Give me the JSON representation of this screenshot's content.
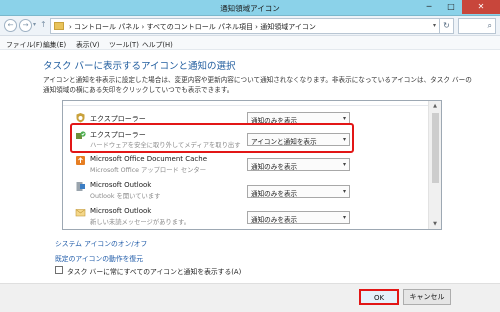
{
  "window": {
    "title": "通知領域アイコン",
    "minimize": "─",
    "maximize": "□",
    "close": "✕"
  },
  "nav": {
    "back": "←",
    "forward": "→",
    "recent": "▾",
    "up": "↑",
    "breadcrumb": "›  コントロール パネル  ›  すべてのコントロール パネル項目  ›  通知領域アイコン",
    "dropdown": "▾",
    "refresh": "↻",
    "search": "⌕"
  },
  "menu": [
    "ファイル(F)",
    "編集(E)",
    "表示(V)",
    "ツール(T)",
    "ヘルプ(H)"
  ],
  "heading": "タスク バーに表示するアイコンと通知の選択",
  "description": "アイコンと通知を非表示に設定した場合は、変更内容や更新内容について通知されなくなります。非表示になっているアイコンは、タスク バーの通知領域の横にある矢印をクリックしていつでも表示できます。",
  "list": {
    "items": [
      {
        "name": "エクスプローラー",
        "sub": "",
        "icon": "explorer-shield-icon",
        "behavior": "通知のみを表示"
      },
      {
        "name": "エクスプローラー",
        "sub": "ハードウェアを安全に取り外してメディアを取り出す",
        "icon": "safely-remove-hardware-icon",
        "behavior": "アイコンと通知を表示"
      },
      {
        "name": "Microsoft Office Document Cache",
        "sub": "Microsoft Office アップロード センター",
        "icon": "office-upload-icon",
        "behavior": "通知のみを表示"
      },
      {
        "name": "Microsoft Outlook",
        "sub": "Outlook を開いています",
        "icon": "outlook-icon",
        "behavior": "通知のみを表示"
      },
      {
        "name": "Microsoft Outlook",
        "sub": "新しい未読メッセージがあります。",
        "icon": "outlook-mail-icon",
        "behavior": "通知のみを表示"
      }
    ],
    "dropdown_arrow": "▾",
    "scroll_up": "▲",
    "scroll_down": "▼"
  },
  "links": {
    "system_icons": "システム アイコンのオン/オフ",
    "restore_defaults": "既定のアイコンの動作を復元"
  },
  "checkbox": {
    "label": "タスク バーに常にすべてのアイコンと通知を表示する(A)",
    "checked": false
  },
  "buttons": {
    "ok": "OK",
    "cancel": "キャンセル"
  },
  "colors": {
    "accent": "#1f5c9e",
    "highlight": "#e21616",
    "titlebar": "#8bd2e9"
  }
}
